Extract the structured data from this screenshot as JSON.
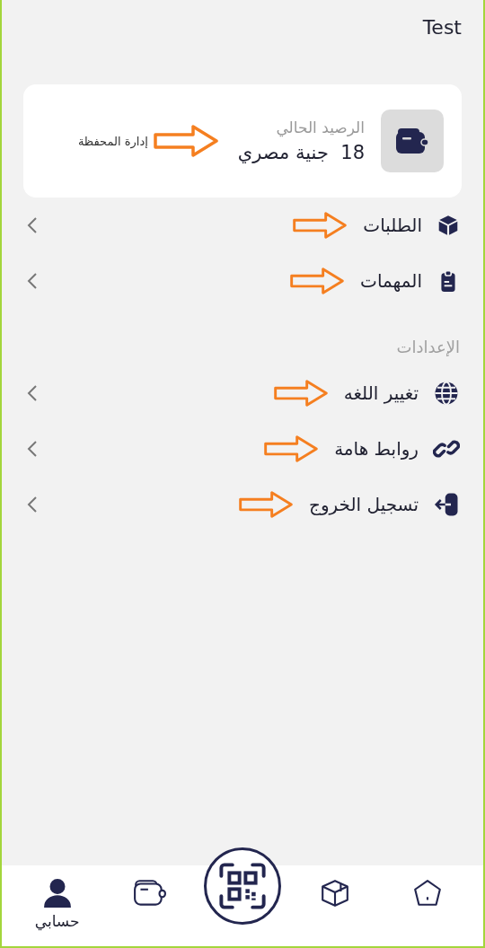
{
  "header": {
    "title": "Test"
  },
  "wallet": {
    "label": "الرصيد الحالي",
    "balance": "18  جنية مصري",
    "link": "إدارة المحفظة"
  },
  "menu": [
    {
      "kind": "box",
      "label": "الطلبات"
    },
    {
      "kind": "clipboard",
      "label": "المهمات"
    }
  ],
  "settings": {
    "title": "الإعدادات",
    "items": [
      {
        "kind": "globe",
        "label": "تغيير اللغه"
      },
      {
        "kind": "link",
        "label": "روابط هامة"
      },
      {
        "kind": "logout",
        "label": "تسجيل الخروج"
      }
    ]
  },
  "nav": [
    {
      "kind": "home",
      "selected": false
    },
    {
      "kind": "box",
      "selected": false
    },
    {
      "kind": "qr",
      "selected": false
    },
    {
      "kind": "wallet",
      "selected": false
    },
    {
      "kind": "person",
      "label": "حسابي",
      "selected": true
    }
  ]
}
